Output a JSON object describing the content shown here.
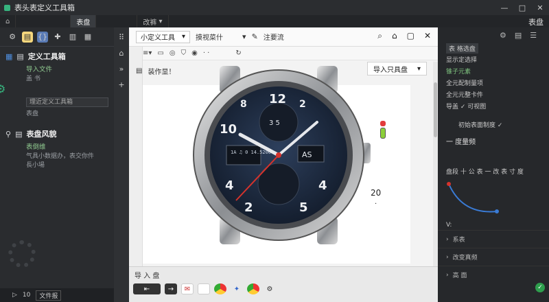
{
  "window": {
    "title": "表头表定义工具箱",
    "header_right": "表盘"
  },
  "tabs": [
    {
      "label": "表盘"
    },
    {
      "label": "表盘"
    },
    {
      "label": "改裤"
    }
  ],
  "left_sidebar": {
    "toolbox": {
      "title": "定义工具箱",
      "sub": "导入文件",
      "note": "盖 书",
      "input_value": "理近定义工具箱",
      "sub2": "表盘"
    },
    "watchstyle": {
      "title": "表盘风貌",
      "sub": "表倒维",
      "note": "气具小数据办，表交你件",
      "sub2": "長小場"
    },
    "bottom": {
      "num": "10",
      "chip": "文件报"
    }
  },
  "main": {
    "toolbar": {
      "select_label": "小定义工具",
      "option_label": "摸视菜什",
      "edit_label": "注要流"
    },
    "doc_label": "装作显！",
    "import_button": "导入只具盘",
    "value_label": "20",
    "bottom_panel_title": "导 入 盘"
  },
  "watch_face": {
    "numerals": [
      "12",
      "2",
      "4",
      "5",
      "2",
      "4",
      "8",
      "10"
    ],
    "subdial_top": "3 5",
    "left_window": "1A ♫ 0\n14.5200",
    "right_window": "AS"
  },
  "right_panel": {
    "tab": "表 格选盘",
    "items": [
      "显示定选择",
      "锥子元素",
      "全元配制量项",
      "全元元整卡件",
      "导盖 ✓ 可视图"
    ],
    "mid_text": "初始表面制度 ✓",
    "heading": "一 度量频",
    "slider_label": "盘段 十 公 表 一 改 表 寸 度",
    "section_v": "V:",
    "rows": [
      "系表",
      "改变真频",
      "高 面"
    ]
  },
  "colors": {
    "accent_green": "#37b37e",
    "dial_blue": "#1e2d44",
    "second_hand_red": "#d6332c"
  }
}
